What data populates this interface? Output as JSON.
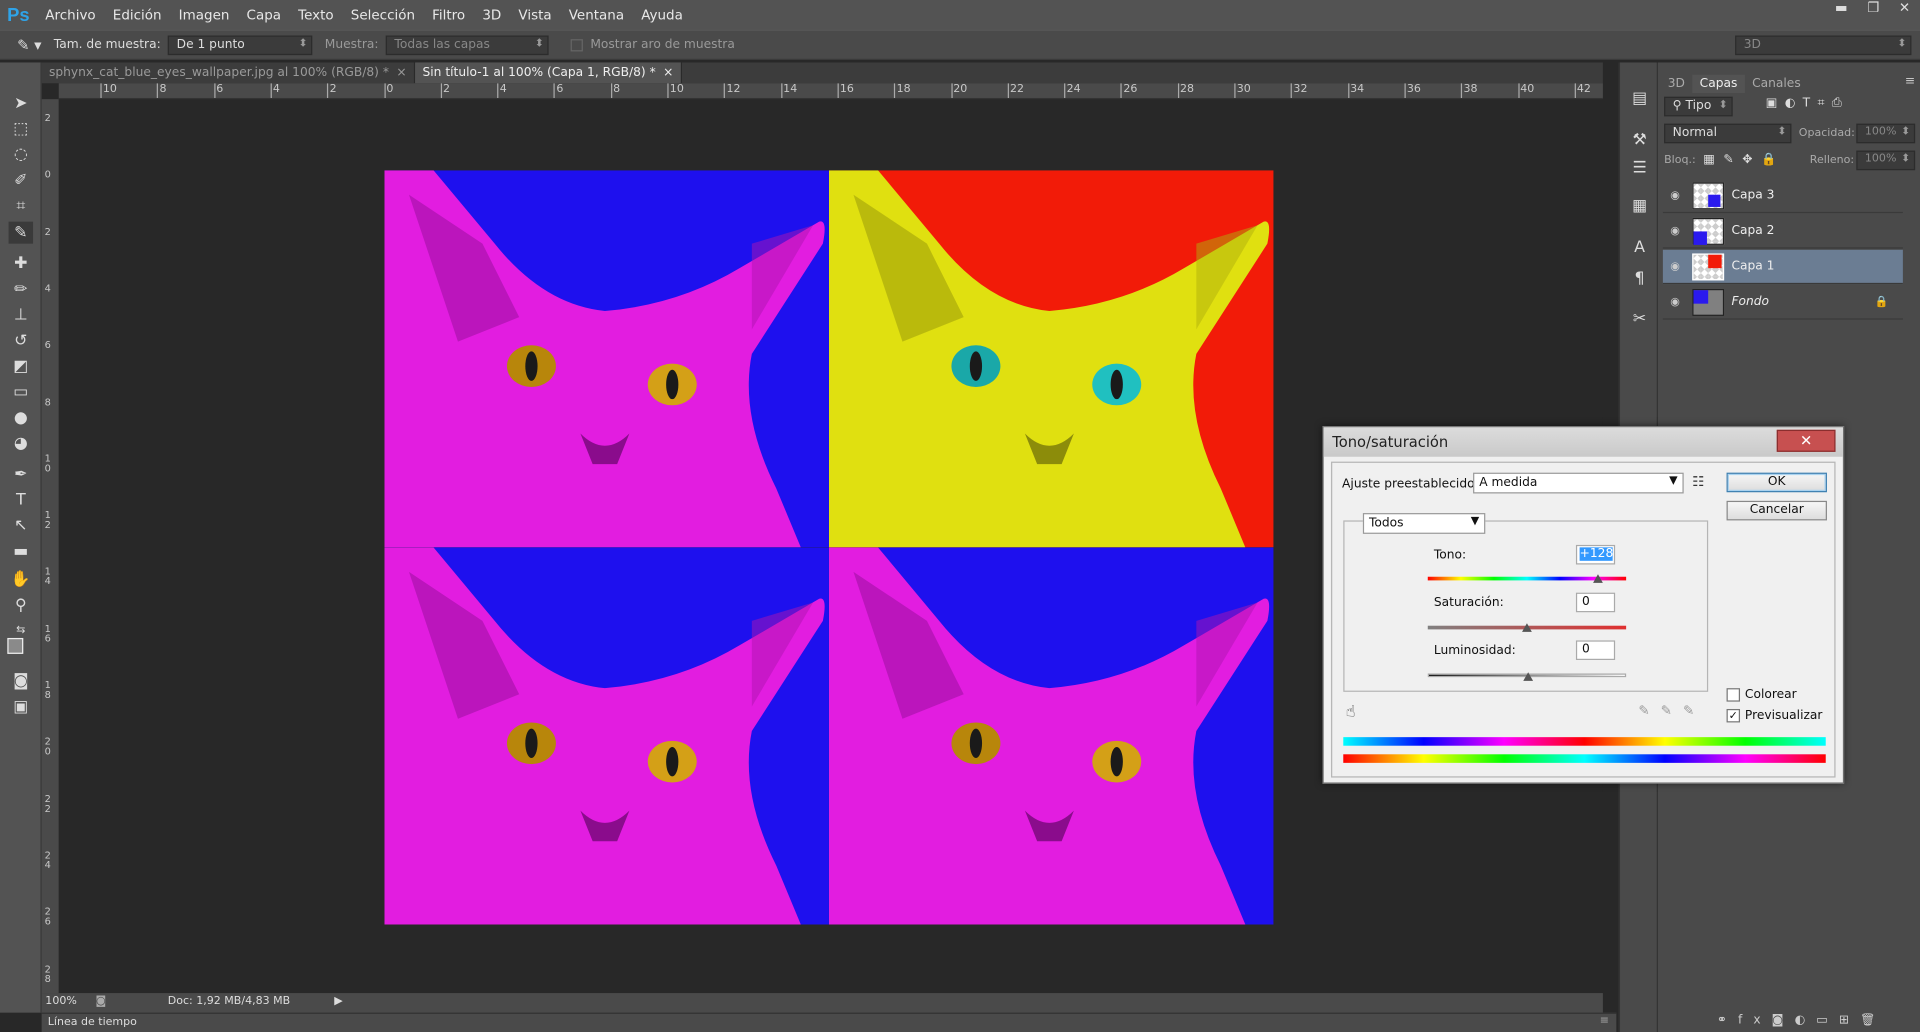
{
  "app": {
    "logo": "Ps"
  },
  "menu": [
    "Archivo",
    "Edición",
    "Imagen",
    "Capa",
    "Texto",
    "Selección",
    "Filtro",
    "3D",
    "Vista",
    "Ventana",
    "Ayuda"
  ],
  "options": {
    "sample_size_label": "Tam. de muestra:",
    "sample_size_value": "De 1 punto",
    "sample_label": "Muestra:",
    "sample_value": "Todas las capas",
    "ring_label": "Mostrar aro de muestra",
    "workspace": "3D"
  },
  "tabs": [
    {
      "label": "sphynx_cat_blue_eyes_wallpaper.jpg al 100% (RGB/8) *",
      "active": false
    },
    {
      "label": "Sin título-1 al 100% (Capa 1, RGB/8) *",
      "active": true
    }
  ],
  "ruler_top": [
    "10",
    "8",
    "6",
    "4",
    "2",
    "0",
    "2",
    "4",
    "6",
    "8",
    "10",
    "12",
    "14",
    "16",
    "18",
    "20",
    "22",
    "24",
    "26",
    "28",
    "30",
    "32",
    "34",
    "36",
    "38",
    "40",
    "42"
  ],
  "ruler_left": [
    "2",
    "0",
    "2",
    "4",
    "6",
    "8",
    "1 0",
    "1 2",
    "1 4",
    "1 6",
    "1 8",
    "2 0",
    "2 2",
    "2 4",
    "2 6",
    "2 8"
  ],
  "status": {
    "zoom": "100%",
    "doc": "Doc: 1,92 MB/4,83 MB"
  },
  "timeline": "Línea de tiempo",
  "layers_panel": {
    "tabs": [
      "3D",
      "Capas",
      "Canales"
    ],
    "filter": "Tipo",
    "blend_mode": "Normal",
    "opacity_label": "Opacidad:",
    "opacity_value": "100%",
    "lock_label": "Bloq.:",
    "fill_label": "Relleno:",
    "fill_value": "100%",
    "layers": [
      {
        "name": "Capa 3",
        "selected": false
      },
      {
        "name": "Capa 2",
        "selected": false
      },
      {
        "name": "Capa 1",
        "selected": true
      },
      {
        "name": "Fondo",
        "selected": false
      }
    ]
  },
  "dialog": {
    "title": "Tono/saturación",
    "close": "✕",
    "preset_label": "Ajuste preestablecido:",
    "preset_value": "A medida",
    "channel": "Todos",
    "hue_label": "Tono:",
    "hue_value": "+128",
    "saturation_label": "Saturación:",
    "saturation_value": "0",
    "lightness_label": "Luminosidad:",
    "lightness_value": "0",
    "ok": "OK",
    "cancel": "Cancelar",
    "colorize_label": "Colorear",
    "preview_label": "Previsualizar",
    "colorize_checked": false,
    "preview_checked": true,
    "hue_level": 0.86,
    "saturation_level": 0.5,
    "lightness_level": 0.5
  },
  "colors": {
    "accent": "#2fa3e8",
    "selected_layer": "#6b7d93",
    "close_button": "#c75050"
  }
}
